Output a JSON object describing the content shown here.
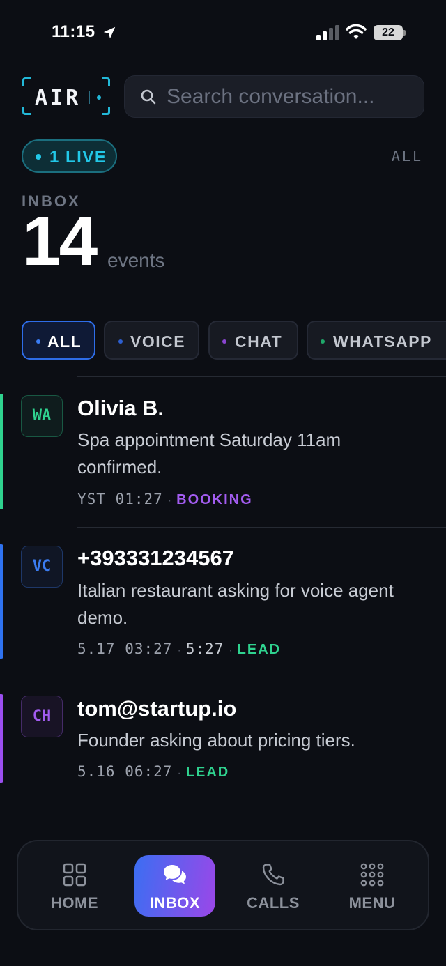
{
  "status_bar": {
    "time": "11:15",
    "battery": "22",
    "icons": [
      "location-arrow-icon",
      "cellular-signal-icon",
      "wifi-icon",
      "battery-icon"
    ]
  },
  "header": {
    "logo_text": "AIR",
    "search_placeholder": "Search conversation...",
    "search_value": ""
  },
  "live_badge": {
    "label": "1 LIVE"
  },
  "all_link": "ALL",
  "inbox": {
    "label": "INBOX",
    "count": "14",
    "unit": "events"
  },
  "filters": [
    {
      "label": "ALL",
      "color": "#3a7df5",
      "active": true
    },
    {
      "label": "VOICE",
      "color": "#2d5fd0",
      "active": false
    },
    {
      "label": "CHAT",
      "color": "#8a45d0",
      "active": false
    },
    {
      "label": "WHATSAPP",
      "color": "#1fa86a",
      "active": false
    }
  ],
  "conversations": [
    {
      "channel": "WA",
      "channel_color": "#2fd28f",
      "accent_color": "#2fd28f",
      "title": "Olivia B.",
      "body": "Spa appointment Saturday 11am confirmed.",
      "date": "YST 01:27",
      "duration": "",
      "tag": "BOOKING",
      "tag_color": "#a35cf0"
    },
    {
      "channel": "VC",
      "channel_color": "#3b7cf0",
      "accent_color": "#2f72f0",
      "title": "+393331234567",
      "body": "Italian restaurant asking for voice agent demo.",
      "date": "5.17 03:27",
      "duration": "5:27",
      "tag": "LEAD",
      "tag_color": "#2fd28f"
    },
    {
      "channel": "CH",
      "channel_color": "#a35cf0",
      "accent_color": "#9b4ff0",
      "title": "tom@startup.io",
      "body": "Founder asking about pricing tiers.",
      "date": "5.16 06:27",
      "duration": "",
      "tag": "LEAD",
      "tag_color": "#2fd28f"
    }
  ],
  "bottom_nav": [
    {
      "label": "HOME",
      "icon": "grid-icon",
      "active": false
    },
    {
      "label": "INBOX",
      "icon": "chat-bubbles-icon",
      "active": true
    },
    {
      "label": "CALLS",
      "icon": "phone-icon",
      "active": false
    },
    {
      "label": "MENU",
      "icon": "dots-grid-icon",
      "active": false
    }
  ]
}
